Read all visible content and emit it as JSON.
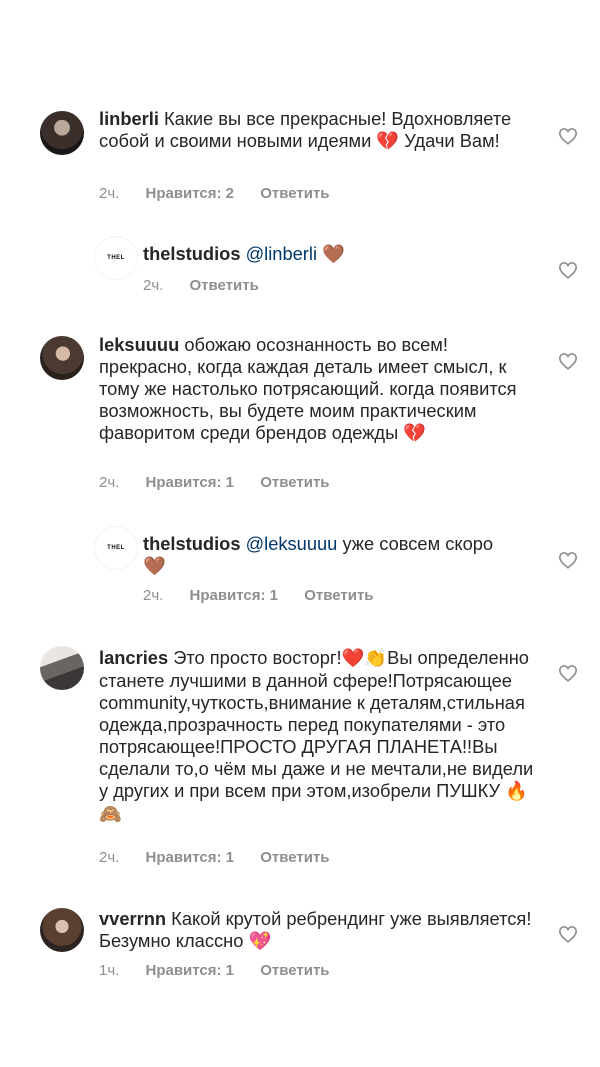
{
  "comments": [
    {
      "username": "linberli",
      "text": "Какие вы все прекрасные! Вдохновляете собой и своими новыми идеями",
      "text_end": "Удачи Вам!",
      "emoji_end": "💔",
      "time": "2ч.",
      "likes": "Нравится: 2",
      "reply": "Ответить",
      "avatar_icon": "profile-photo"
    },
    {
      "username": "thelstudios",
      "brand_mark": "THEL",
      "mention": "@linberli",
      "emoji": "🤎",
      "time": "2ч.",
      "reply": "Ответить"
    },
    {
      "username": "leksuuuu",
      "text": "обожаю осознанность во всем! прекрасно, когда каждая деталь имеет смысл, к тому же настолько потрясающий. когда появится возможность, вы будете моим практическим фаворитом среди брендов одежды",
      "emoji_end": "💔",
      "time": "2ч.",
      "likes": "Нравится: 1",
      "reply": "Ответить"
    },
    {
      "username": "thelstudios",
      "brand_mark": "THEL",
      "mention": "@leksuuuu",
      "text": "уже совсем скоро",
      "emoji": "🤎",
      "time": "2ч.",
      "likes": "Нравится: 1",
      "reply": "Ответить"
    },
    {
      "username": "lancries",
      "text_a": "Это просто восторг!",
      "emoji_a": "❤️👏",
      "text_b": "Вы определенно станете лучшими в данной сфере!Потрясающее community,чуткость,внимание к деталям,стильная одежда,прозрачность перед покупателями - это потрясающее!ПРОСТО ДРУГАЯ ПЛАНЕТА!!Вы сделали то,о чём мы даже и не мечтали,не видели у других и при всем при этом,изобрели ПУШКУ",
      "emoji_end": "🔥🙈",
      "time": "2ч.",
      "likes": "Нравится: 1",
      "reply": "Ответить"
    },
    {
      "username": "vverrnn",
      "text": "Какой крутой ребрендинг уже выявляется! Безумно классно",
      "emoji_end": "💖",
      "time": "1ч.",
      "likes": "Нравится: 1",
      "reply": "Ответить"
    }
  ],
  "colors": {
    "text": "#262626",
    "meta": "#8e8e8e",
    "mention": "#00376b",
    "heart": "#8e8e8e"
  }
}
